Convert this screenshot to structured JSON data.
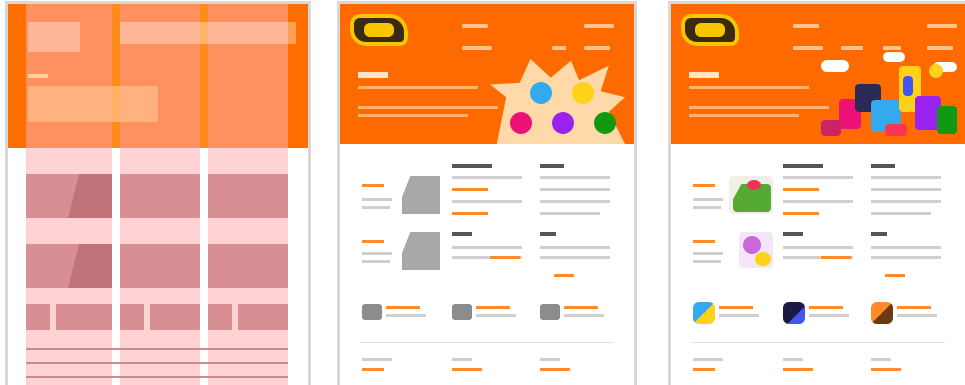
{
  "panels": [
    {
      "id": "grid-wireframe"
    },
    {
      "id": "layout-mockup"
    },
    {
      "id": "final-design"
    }
  ],
  "colors": {
    "brand_orange": "#ff6a00",
    "header_light": "#ff8c1a",
    "wire_pink": "#f4b6b6",
    "placeholder_grey": "#a8a8a8",
    "link_orange": "#ff8a2a"
  },
  "mockup_dots": [
    "#33aaee",
    "#ffd21a",
    "#ee1177",
    "#9922ee",
    "#119911"
  ],
  "icons": [
    "logo-icon",
    "cloud-icon",
    "character-art-icon"
  ]
}
